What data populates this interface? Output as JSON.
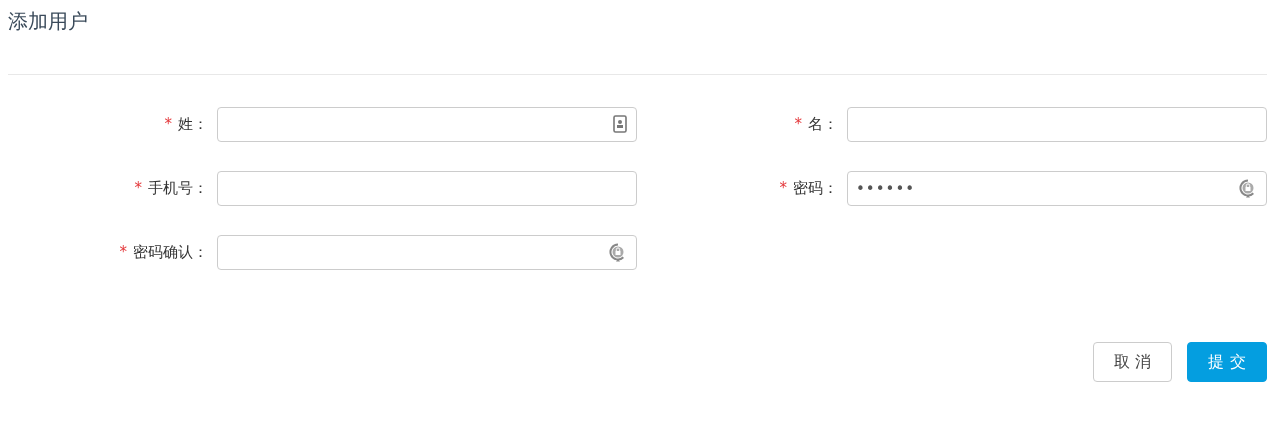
{
  "title": "添加用户",
  "fields": [
    {
      "label": "姓：",
      "required": true,
      "kind": "contact"
    },
    {
      "label": "名：",
      "required": true,
      "kind": "plain"
    },
    {
      "label": "手机号：",
      "required": true,
      "kind": "plain"
    },
    {
      "label": "密码：",
      "required": true,
      "kind": "password",
      "value": "••••••"
    },
    {
      "label": "密码确认：",
      "required": true,
      "kind": "password"
    }
  ],
  "required_mark": "*",
  "buttons": [
    {
      "label": "取 消",
      "kind": "secondary"
    },
    {
      "label": "提 交",
      "kind": "primary"
    }
  ]
}
